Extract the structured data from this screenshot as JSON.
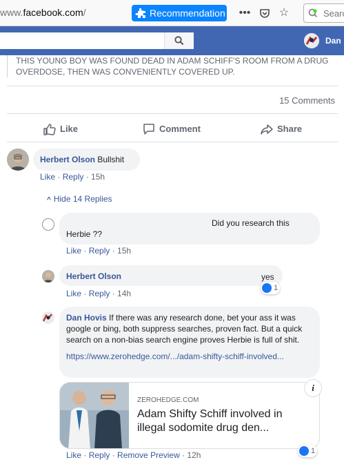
{
  "browser": {
    "url_prefix": "www.",
    "url_domain": "facebook.com",
    "url_suffix": "/",
    "recommendation_label": "Recommendation",
    "search_placeholder": "Search"
  },
  "facebook": {
    "user_name": "Dan"
  },
  "post": {
    "text": "THIS YOUNG BOY WAS FOUND DEAD IN ADAM SCHIFF'S ROOM FROM A DRUG OVERDOSE, THEN WAS CONVENIENTLY COVERED UP.",
    "comments_count": "15 Comments",
    "actions": {
      "like": "Like",
      "comment": "Comment",
      "share": "Share"
    }
  },
  "comments": [
    {
      "author": "Herbert Olson",
      "text": "Bullshit",
      "meta": {
        "like": "Like",
        "reply": "Reply",
        "time": "15h"
      },
      "hide_replies": "Hide 14 Replies",
      "replies": [
        {
          "text_line1": "Did you research this",
          "text_line2": "Herbie ??",
          "meta": {
            "like": "Like",
            "reply": "Reply",
            "time": "15h"
          }
        },
        {
          "author": "Herbert Olson",
          "text": "yes",
          "reactions": "1",
          "meta": {
            "like": "Like",
            "reply": "Reply",
            "time": "14h"
          }
        },
        {
          "author": "Dan Hovis",
          "text": "If there was any research done, bet your ass it was google or bing, both suppress searches, proven fact. But a quick search on a non-bias search engine proves Herbie is full of shit.",
          "link": "https://www.zerohedge.com/.../adam-shifty-schiff-involved...",
          "preview": {
            "domain": "ZEROHEDGE.COM",
            "title": "Adam Shifty Schiff involved in illegal sodomite drug den..."
          },
          "reactions": "1",
          "meta": {
            "like": "Like",
            "reply": "Reply",
            "remove_preview": "Remove Preview",
            "time": "12h"
          }
        }
      ]
    }
  ],
  "colors": {
    "facebook_blue": "#4267b2",
    "link_blue": "#385898",
    "firefox_blue": "#0a84ff"
  }
}
